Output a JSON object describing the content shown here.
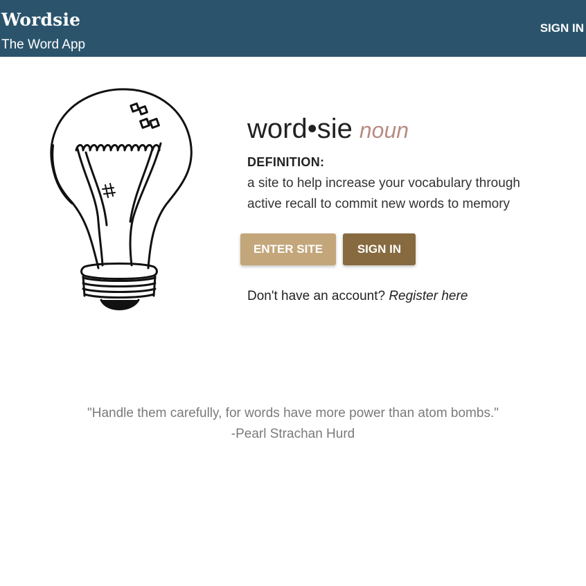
{
  "header": {
    "brand_name": "Wordsie",
    "tagline": "The Word App",
    "sign_in_label": "SIGN IN",
    "background_color": "#2b546c"
  },
  "hero": {
    "illustration": "lightbulb-illustration",
    "word": "word•sie",
    "part_of_speech": "noun",
    "definition_label": "DEFINITION:",
    "definition_text": "a site to help increase your vocabulary through active recall to commit new words to memory",
    "enter_site_label": "ENTER SITE",
    "sign_in_label": "SIGN IN",
    "register_prompt": "Don't have an account?",
    "register_link": "Register here",
    "colors": {
      "part_of_speech": "#b88c83",
      "enter_site_button": "#c3a67a",
      "sign_in_button": "#876a3f"
    }
  },
  "quote": {
    "text": "\"Handle them carefully, for words have more power than atom bombs.\"",
    "author": "-Pearl Strachan Hurd"
  }
}
